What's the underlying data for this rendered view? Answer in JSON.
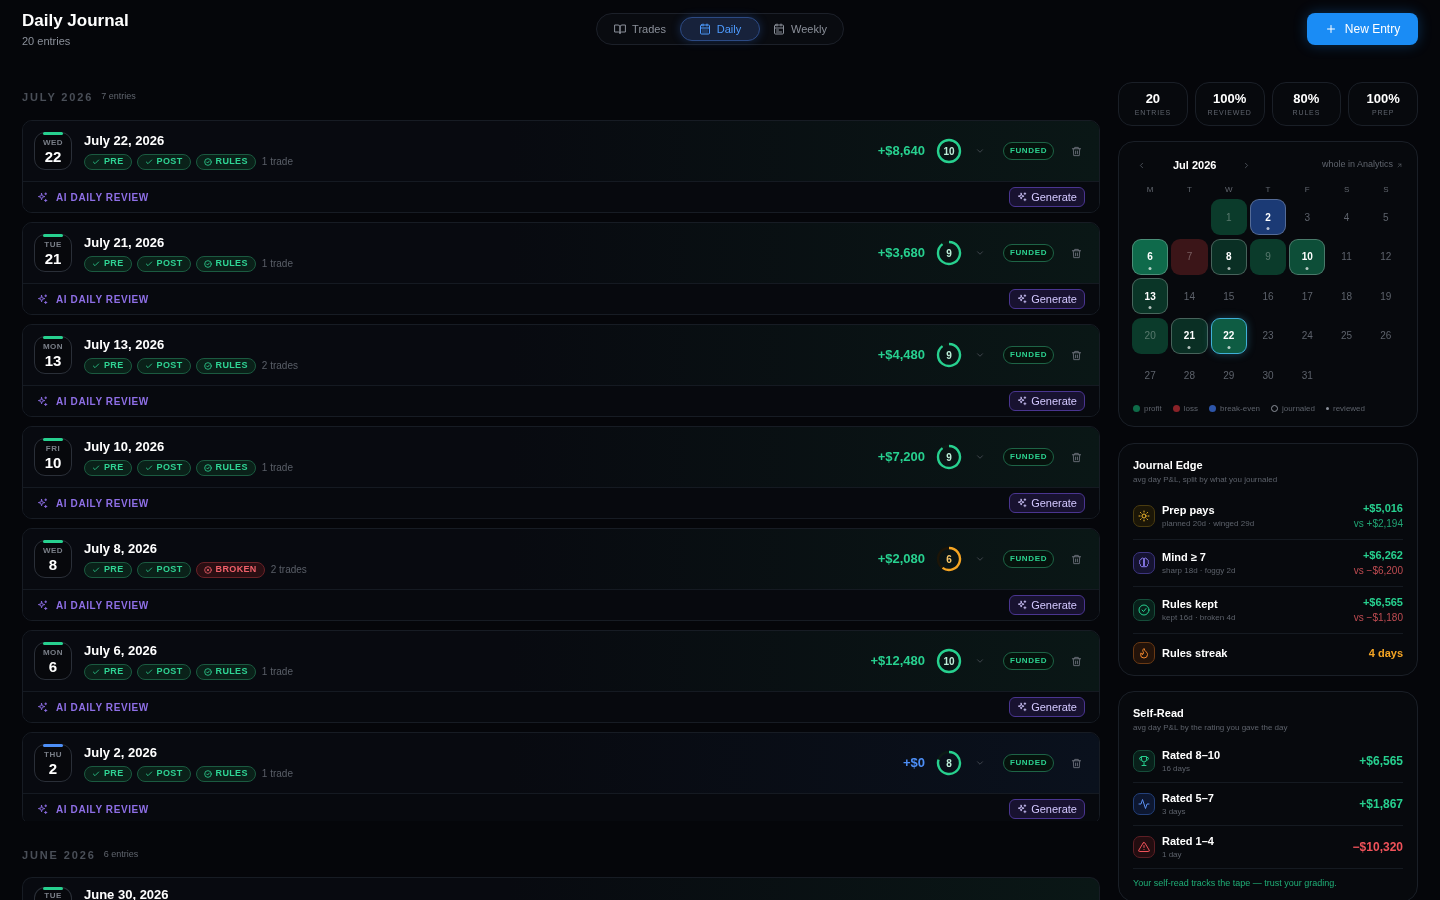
{
  "header": {
    "title": "Daily Journal",
    "subtitle": "20 entries"
  },
  "view_tabs": [
    {
      "label": "Trades",
      "kind": "trades",
      "selected": false
    },
    {
      "label": "Daily",
      "kind": "daily",
      "selected": true
    },
    {
      "label": "Weekly",
      "kind": "weekly",
      "selected": false
    }
  ],
  "new_entry_button": {
    "label": "New Entry"
  },
  "sections": [
    {
      "title": "JULY 2026",
      "count": "7 entries",
      "entries": [
        {
          "kind": "profit",
          "weekday": "WED",
          "day": "22",
          "title": "July 22, 2026",
          "tags": [
            {
              "label": "PRE",
              "kind": "check"
            },
            {
              "label": "POST",
              "kind": "check"
            },
            {
              "label": "RULES",
              "kind": "rules"
            }
          ],
          "trades": "1 trade",
          "pnl": "+$8,640",
          "score": {
            "value": "10",
            "level": 1
          },
          "account": "FUNDED",
          "review": {
            "label": "AI DAILY REVIEW",
            "button": "Generate"
          }
        },
        {
          "kind": "profit",
          "weekday": "TUE",
          "day": "21",
          "title": "July 21, 2026",
          "tags": [
            {
              "label": "PRE",
              "kind": "check"
            },
            {
              "label": "POST",
              "kind": "check"
            },
            {
              "label": "RULES",
              "kind": "rules"
            }
          ],
          "trades": "1 trade",
          "pnl": "+$3,680",
          "score": {
            "value": "9",
            "level": 0.9
          },
          "account": "FUNDED",
          "review": {
            "label": "AI DAILY REVIEW",
            "button": "Generate"
          }
        },
        {
          "kind": "profit",
          "weekday": "MON",
          "day": "13",
          "title": "July 13, 2026",
          "tags": [
            {
              "label": "PRE",
              "kind": "check"
            },
            {
              "label": "POST",
              "kind": "check"
            },
            {
              "label": "RULES",
              "kind": "rules"
            }
          ],
          "trades": "2 trades",
          "pnl": "+$4,480",
          "score": {
            "value": "9",
            "level": 0.9
          },
          "account": "FUNDED",
          "review": {
            "label": "AI DAILY REVIEW",
            "button": "Generate"
          }
        },
        {
          "kind": "profit",
          "weekday": "FRI",
          "day": "10",
          "title": "July 10, 2026",
          "tags": [
            {
              "label": "PRE",
              "kind": "check"
            },
            {
              "label": "POST",
              "kind": "check"
            },
            {
              "label": "RULES",
              "kind": "rules"
            }
          ],
          "trades": "1 trade",
          "pnl": "+$7,200",
          "score": {
            "value": "9",
            "level": 0.9
          },
          "account": "FUNDED",
          "review": {
            "label": "AI DAILY REVIEW",
            "button": "Generate"
          }
        },
        {
          "kind": "profit",
          "weekday": "WED",
          "day": "8",
          "title": "July 8, 2026",
          "tags": [
            {
              "label": "PRE",
              "kind": "check"
            },
            {
              "label": "POST",
              "kind": "check"
            },
            {
              "label": "BROKEN",
              "kind": "broken"
            }
          ],
          "trades": "2 trades",
          "pnl": "+$2,080",
          "score": {
            "value": "6",
            "level": 0.6
          },
          "account": "FUNDED",
          "review": {
            "label": "AI DAILY REVIEW",
            "button": "Generate"
          }
        },
        {
          "kind": "profit",
          "weekday": "MON",
          "day": "6",
          "title": "July 6, 2026",
          "tags": [
            {
              "label": "PRE",
              "kind": "check"
            },
            {
              "label": "POST",
              "kind": "check"
            },
            {
              "label": "RULES",
              "kind": "rules"
            }
          ],
          "trades": "1 trade",
          "pnl": "+$12,480",
          "score": {
            "value": "10",
            "level": 1
          },
          "account": "FUNDED",
          "review": {
            "label": "AI DAILY REVIEW",
            "button": "Generate"
          }
        },
        {
          "kind": "breakeven",
          "weekday": "THU",
          "day": "2",
          "title": "July 2, 2026",
          "tags": [
            {
              "label": "PRE",
              "kind": "check"
            },
            {
              "label": "POST",
              "kind": "check"
            },
            {
              "label": "RULES",
              "kind": "rules"
            }
          ],
          "trades": "1 trade",
          "pnl": "+$0",
          "score": {
            "value": "8",
            "level": 0.8
          },
          "account": "FUNDED",
          "review": {
            "label": "AI DAILY REVIEW",
            "button": "Generate"
          }
        }
      ]
    },
    {
      "title": "JUNE 2026",
      "count": "6 entries",
      "entries": [
        {
          "kind": "profit",
          "weekday": "TUE",
          "title": "June 30, 2026"
        }
      ]
    }
  ],
  "stats": [
    {
      "value": "20",
      "label": "ENTRIES"
    },
    {
      "value": "100%",
      "label": "REVIEWED"
    },
    {
      "value": "80%",
      "label": "RULES"
    },
    {
      "value": "100%",
      "label": "PREP"
    }
  ],
  "calendar": {
    "month": "Jul 2026",
    "link": "whole in Analytics",
    "weekdays": [
      "M",
      "T",
      "W",
      "T",
      "F",
      "S",
      "S"
    ],
    "days": [
      {
        "day": "1",
        "color": "#0b3b2b",
        "journaled": false,
        "reviewed": false,
        "selected": false
      },
      {
        "day": "2",
        "color": "#1b3a75",
        "journaled": true,
        "reviewed": true,
        "selected": false
      },
      {
        "day": "3",
        "journaled": false,
        "reviewed": false,
        "selected": false
      },
      {
        "day": "4",
        "journaled": false,
        "reviewed": false,
        "selected": false
      },
      {
        "day": "5",
        "journaled": false,
        "reviewed": false,
        "selected": false
      },
      {
        "day": "6",
        "color": "#0f6a4b",
        "journaled": true,
        "reviewed": true,
        "selected": false
      },
      {
        "day": "7",
        "color": "#3b1518",
        "journaled": false,
        "reviewed": false,
        "selected": false
      },
      {
        "day": "8",
        "color": "#0a2f24",
        "journaled": true,
        "reviewed": true,
        "selected": false
      },
      {
        "day": "9",
        "color": "#0b3b2b",
        "journaled": false,
        "reviewed": false,
        "selected": false
      },
      {
        "day": "10",
        "color": "#0d4e38",
        "journaled": true,
        "reviewed": true,
        "selected": false
      },
      {
        "day": "11",
        "journaled": false,
        "reviewed": false,
        "selected": false
      },
      {
        "day": "12",
        "journaled": false,
        "reviewed": false,
        "selected": false
      },
      {
        "day": "13",
        "color": "#0a3527",
        "journaled": true,
        "reviewed": true,
        "selected": false
      },
      {
        "day": "14",
        "journaled": false,
        "reviewed": false,
        "selected": false
      },
      {
        "day": "15",
        "journaled": false,
        "reviewed": false,
        "selected": false
      },
      {
        "day": "16",
        "journaled": false,
        "reviewed": false,
        "selected": false
      },
      {
        "day": "17",
        "journaled": false,
        "reviewed": false,
        "selected": false
      },
      {
        "day": "18",
        "journaled": false,
        "reviewed": false,
        "selected": false
      },
      {
        "day": "19",
        "journaled": false,
        "reviewed": false,
        "selected": false
      },
      {
        "day": "20",
        "color": "#0b3b2b",
        "journaled": false,
        "reviewed": false,
        "selected": false
      },
      {
        "day": "21",
        "color": "#0a2f24",
        "journaled": true,
        "reviewed": true,
        "selected": false
      },
      {
        "day": "22",
        "color": "#0e5c43",
        "journaled": true,
        "reviewed": true,
        "selected": true
      },
      {
        "day": "23",
        "journaled": false,
        "reviewed": false,
        "selected": false
      },
      {
        "day": "24",
        "journaled": false,
        "reviewed": false,
        "selected": false
      },
      {
        "day": "25",
        "journaled": false,
        "reviewed": false,
        "selected": false
      },
      {
        "day": "26",
        "journaled": false,
        "reviewed": false,
        "selected": false
      },
      {
        "day": "27",
        "journaled": false,
        "reviewed": false,
        "selected": false
      },
      {
        "day": "28",
        "journaled": false,
        "reviewed": false,
        "selected": false
      },
      {
        "day": "29",
        "journaled": false,
        "reviewed": false,
        "selected": false
      },
      {
        "day": "30",
        "journaled": false,
        "reviewed": false,
        "selected": false
      },
      {
        "day": "31",
        "journaled": false,
        "reviewed": false,
        "selected": false
      }
    ],
    "legend": [
      {
        "label": "profit",
        "kind": "dot",
        "color": "#0e6b48"
      },
      {
        "label": "loss",
        "kind": "dot",
        "color": "#8a2228"
      },
      {
        "label": "break-even",
        "kind": "dot",
        "color": "#2d55a8"
      },
      {
        "label": "journaled",
        "kind": "ring"
      },
      {
        "label": "reviewed",
        "kind": "pip"
      }
    ]
  },
  "journal_edge": {
    "title": "Journal Edge",
    "subtitle": "avg day P&L, split by what you journaled",
    "rows": [
      {
        "kind": "prep",
        "title": "Prep pays",
        "detail": "planned 20d · winged 29d",
        "value": "+$5,016",
        "value_negative": false,
        "compare": "vs +$2,194",
        "compare_negative": false
      },
      {
        "kind": "mind",
        "title": "Mind ≥ 7",
        "detail": "sharp 18d · foggy 2d",
        "value": "+$6,262",
        "value_negative": false,
        "compare": "vs −$6,200",
        "compare_negative": true
      },
      {
        "kind": "rules",
        "title": "Rules kept",
        "detail": "kept 16d · broken 4d",
        "value": "+$6,565",
        "value_negative": false,
        "compare": "vs −$1,180",
        "compare_negative": true
      },
      {
        "kind": "streak",
        "title": "Rules streak",
        "value": "4 days",
        "value_negative": false
      }
    ]
  },
  "self_read": {
    "title": "Self-Read",
    "subtitle": "avg day P&L by the rating you gave the day",
    "rows": [
      {
        "kind": "high",
        "title": "Rated 8–10",
        "detail": "16 days",
        "value": "+$6,565",
        "value_negative": false
      },
      {
        "kind": "mid",
        "title": "Rated 5–7",
        "detail": "3 days",
        "value": "+$1,867",
        "value_negative": false
      },
      {
        "kind": "low",
        "title": "Rated 1–4",
        "detail": "1 day",
        "value": "−$10,320",
        "value_negative": true
      }
    ],
    "footer": "Your self-read tracks the tape — trust your grading."
  }
}
